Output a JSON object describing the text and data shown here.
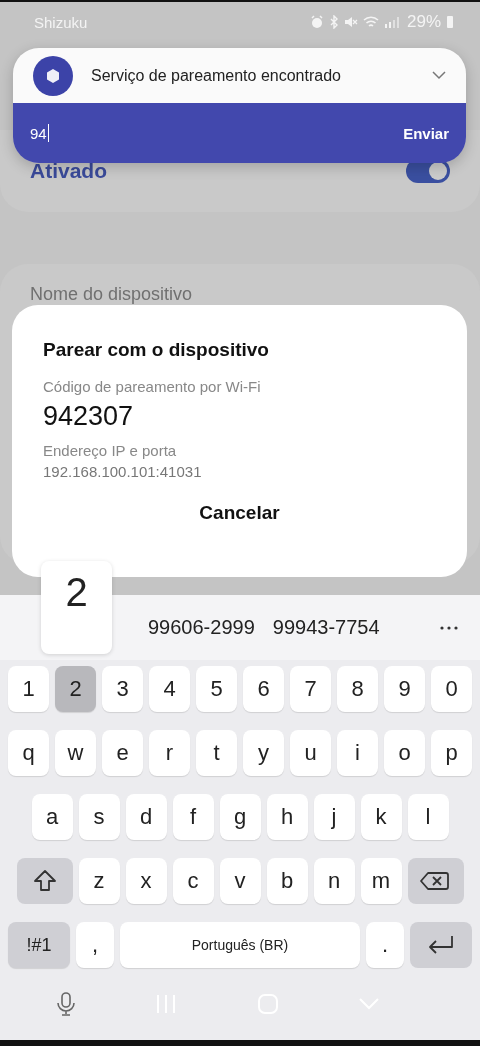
{
  "status_bar": {
    "app": "Shizuku",
    "battery": "29%"
  },
  "background": {
    "status_label": "Ativado",
    "switch_on": true,
    "field_label": "Nome do dispositivo"
  },
  "notification": {
    "title": "Serviço de pareamento encontrado",
    "reply_value": "94",
    "send_label": "Enviar"
  },
  "dialog": {
    "title": "Parear com o dispositivo",
    "code_label": "Código de pareamento por Wi-Fi",
    "code": "942307",
    "address_label": "Endereço IP e porta",
    "address": "192.168.100.101:41031",
    "cancel_label": "Cancelar"
  },
  "keyboard": {
    "key_preview": "2",
    "suggestions": [
      "99606-2999",
      "99943-7754"
    ],
    "number_row": [
      {
        "label": "1",
        "pressed": false
      },
      {
        "label": "2",
        "pressed": true
      },
      {
        "label": "3",
        "pressed": false
      },
      {
        "label": "4",
        "pressed": false
      },
      {
        "label": "5",
        "pressed": false
      },
      {
        "label": "6",
        "pressed": false
      },
      {
        "label": "7",
        "pressed": false
      },
      {
        "label": "8",
        "pressed": false
      },
      {
        "label": "9",
        "pressed": false
      },
      {
        "label": "0",
        "pressed": false
      }
    ],
    "letter_rows": [
      [
        "q",
        "w",
        "e",
        "r",
        "t",
        "y",
        "u",
        "i",
        "o",
        "p"
      ],
      [
        "a",
        "s",
        "d",
        "f",
        "g",
        "h",
        "j",
        "k",
        "l"
      ],
      [
        "z",
        "x",
        "c",
        "v",
        "b",
        "n",
        "m"
      ]
    ],
    "bottom_row": [
      {
        "kind": "symbols",
        "label": "!#1"
      },
      {
        "kind": "char",
        "label": ","
      },
      {
        "kind": "space",
        "label": "Português (BR)"
      },
      {
        "kind": "char",
        "label": "."
      },
      {
        "kind": "enter"
      }
    ]
  }
}
